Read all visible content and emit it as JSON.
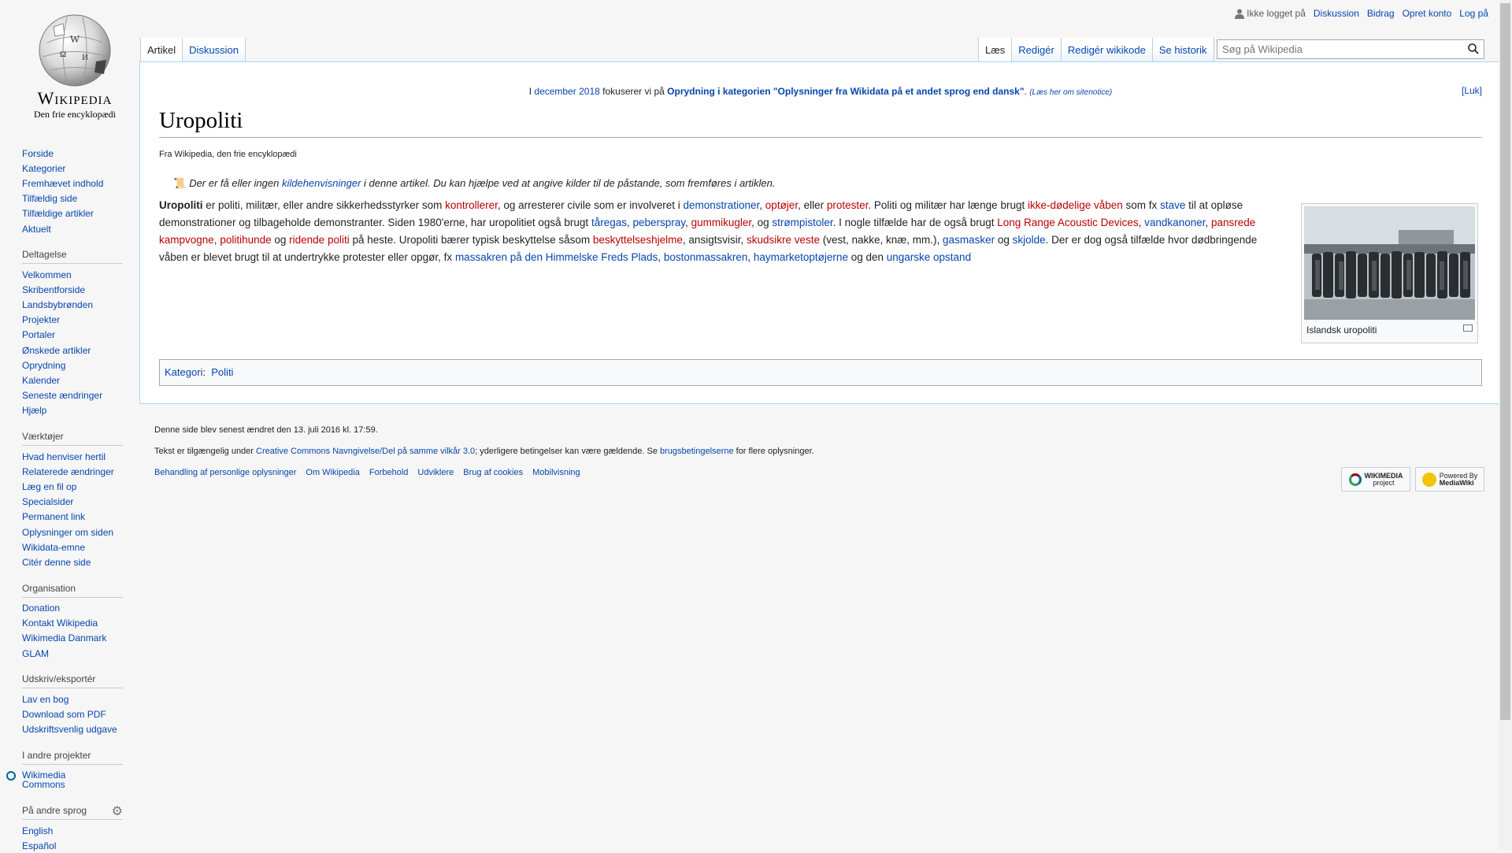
{
  "logo": {
    "wordmark": "Wikipedia",
    "tagline": "Den frie encyklopædi"
  },
  "sidebar": {
    "navigation": [
      "Forside",
      "Kategorier",
      "Fremhævet indhold",
      "Tilfældig side",
      "Tilfældige artikler",
      "Aktuelt"
    ],
    "participation": {
      "heading": "Deltagelse",
      "items": [
        "Velkommen",
        "Skribentforside",
        "Landsbybrønden",
        "Projekter",
        "Portaler",
        "Ønskede artikler",
        "Oprydning",
        "Kalender",
        "Seneste ændringer",
        "Hjælp"
      ]
    },
    "tools": {
      "heading": "Værktøjer",
      "items": [
        "Hvad henviser hertil",
        "Relaterede ændringer",
        "Læg en fil op",
        "Specialsider",
        "Permanent link",
        "Oplysninger om siden",
        "Wikidata-emne",
        "Citér denne side"
      ]
    },
    "organisation": {
      "heading": "Organisation",
      "items": [
        "Donation",
        "Kontakt Wikipedia",
        "Wikimedia Danmark",
        "GLAM"
      ]
    },
    "print": {
      "heading": "Udskriv/eksportér",
      "items": [
        "Lav en bog",
        "Download som PDF",
        "Udskriftsvenlig udgave"
      ]
    },
    "projects": {
      "heading": "I andre projekter",
      "item1": "Wikimedia",
      "item2": "Commons"
    },
    "languages": {
      "heading": "På andre sprog",
      "items": [
        "English",
        "Español"
      ]
    }
  },
  "personal": {
    "not_logged": "Ikke logget på",
    "links": [
      "Diskussion",
      "Bidrag",
      "Opret konto",
      "Log på"
    ]
  },
  "tabs_left": [
    "Artikel",
    "Diskussion"
  ],
  "tabs_right": [
    "Læs",
    "Redigér",
    "Redigér wikikode",
    "Se historik"
  ],
  "search": {
    "placeholder": "Søg på Wikipedia"
  },
  "sitenotice": {
    "prefix": "I ",
    "month_link": "december 2018",
    "mid": " fokuserer vi på ",
    "bold_link": "Oprydning i kategorien \"Oplysninger fra Wikidata på et andet sprog end dansk\"",
    "dot": ". ",
    "small": "(Læs her om sitenotice)",
    "close": "[Luk]"
  },
  "article": {
    "title": "Uropoliti",
    "sitesub": "Fra Wikipedia, den frie encyklopædi",
    "hatnote": {
      "t1": "Der er få eller ingen ",
      "link": "kildehenvisninger",
      "t2": " i denne artikel. Du kan hjælpe ved at angive kilder til de påstande, som fremføres i artiklen."
    },
    "lead": [
      {
        "b": "Uropoliti"
      },
      {
        "t": " er politi, militær, eller andre sikkerhedsstyrker som "
      },
      {
        "r": "kontrollerer"
      },
      {
        "t": ", og arresterer civile som er involveret i "
      },
      {
        "a": "demonstrationer"
      },
      {
        "t": ", "
      },
      {
        "r": "optøjer"
      },
      {
        "t": ", eller "
      },
      {
        "r": "protester"
      },
      {
        "t": ". Politi og militær har længe brugt "
      },
      {
        "r": "ikke-dødelige våben"
      },
      {
        "t": " som fx "
      },
      {
        "a": "stave"
      },
      {
        "t": " til at opløse demonstrationer og tilbageholde demonstranter. Siden 1980'erne, har uropolitiet også brugt "
      },
      {
        "a": "tåregas"
      },
      {
        "t": ", "
      },
      {
        "a": "peberspray"
      },
      {
        "t": ", "
      },
      {
        "r": "gummikugler"
      },
      {
        "t": ", og "
      },
      {
        "a": "strømpistoler"
      },
      {
        "t": ". I nogle tilfælde har de også brugt "
      },
      {
        "r": "Long Range Acoustic Devices"
      },
      {
        "t": ", "
      },
      {
        "a": "vandkanoner"
      },
      {
        "t": ", "
      },
      {
        "r": "pansrede kampvogne"
      },
      {
        "t": ", "
      },
      {
        "r": "politihunde"
      },
      {
        "t": " og "
      },
      {
        "r": "ridende politi"
      },
      {
        "t": " på heste. Uropoliti bærer typisk beskyttelse såsom "
      },
      {
        "r": "beskyttelseshjelme"
      },
      {
        "t": ", ansigtsvisir, "
      },
      {
        "r": "skudsikre veste"
      },
      {
        "t": " (vest, nakke, knæ, mm.), "
      },
      {
        "a": "gasmasker"
      },
      {
        "t": " og "
      },
      {
        "a": "skjolde"
      },
      {
        "t": ". Der er dog også tilfælde hvor dødbringende våben er blevet brugt til at undertrykke protester eller opgør, fx "
      },
      {
        "a": "massakren på den Himmelske Freds Plads"
      },
      {
        "t": ", "
      },
      {
        "a": "bostonmassakren"
      },
      {
        "t": ", "
      },
      {
        "a": "haymarketoptøjerne"
      },
      {
        "t": " og den "
      },
      {
        "a": "ungarske opstand"
      }
    ],
    "thumb_caption": "Islandsk uropoliti",
    "category_label": "Kategori",
    "category": "Politi"
  },
  "footer": {
    "lastmod": "Denne side blev senest ændret den 13. juli 2016 kl. 17:59.",
    "license_pre": "Tekst er tilgængelig under ",
    "license_link": "Creative Commons Navngivelse/Del på samme vilkår 3.0",
    "license_mid": "; yderligere betingelser kan være gældende. Se ",
    "terms_link": "brugsbetingelserne",
    "license_post": " for flere oplysninger.",
    "links": [
      "Behandling af personlige oplysninger",
      "Om Wikipedia",
      "Forbehold",
      "Udviklere",
      "Brug af cookies",
      "Mobilvisning"
    ],
    "badge1_a": "WIKIMEDIA",
    "badge1_b": "project",
    "badge2_a": "Powered By",
    "badge2_b": "MediaWiki"
  }
}
